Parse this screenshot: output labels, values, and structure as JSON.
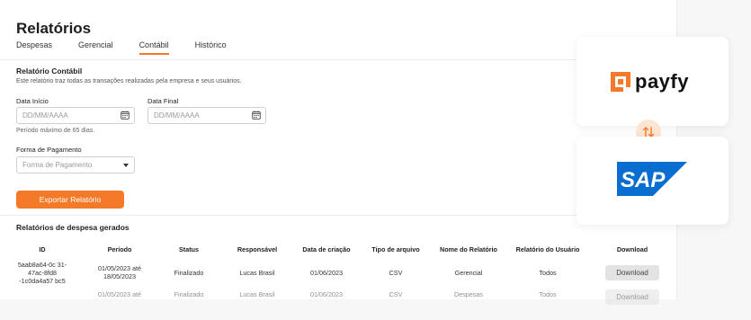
{
  "page": {
    "title": "Relatórios",
    "tabs": [
      {
        "label": "Despesas",
        "active": false
      },
      {
        "label": "Gerencial",
        "active": false
      },
      {
        "label": "Contábil",
        "active": true
      },
      {
        "label": "Histórico",
        "active": false
      }
    ]
  },
  "report": {
    "title": "Relatório Contábil",
    "description": "Este relatório traz todas as transações realizadas pela empresa e seus usuários.",
    "start_label": "Data Início",
    "start_placeholder": "DD/MM/AAAA",
    "end_label": "Data Final",
    "end_placeholder": "DD/MM/AAAA",
    "hint": "Período máximo de 65 dias.",
    "payment_label": "Forma de Pagamento",
    "payment_placeholder": "Forma de Pagamento",
    "export_label": "Exportar Relatório"
  },
  "table": {
    "title": "Relatórios de despesa gerados",
    "headers": [
      "ID",
      "Período",
      "Status",
      "Responsável",
      "Data de criação",
      "Tipo de arquivo",
      "Nome do Relatório",
      "Relatório do Usuário",
      "Download"
    ],
    "rows": [
      {
        "id": "5aab8a64-0c 31-47ac-8fd8 -1c0da4a57 bc5",
        "period": "01/05/2023 até 18/05/2023",
        "status": "Finalizado",
        "responsible": "Lucas Brasil",
        "created": "01/06/2023",
        "file_type": "CSV",
        "report_name": "Gerencial",
        "user_report": "Todos",
        "download": "Download"
      },
      {
        "id": "",
        "period": "01/05/2023 até",
        "status": "Finalizado",
        "responsible": "Lucas Brasil",
        "created": "01/06/2023",
        "file_type": "CSV",
        "report_name": "Despesas",
        "user_report": "Todos",
        "download": "Download"
      }
    ]
  },
  "integrations": {
    "payfy_text": "payfy",
    "sap_text": "SAP",
    "swap_icon": "swap-vertical-icon"
  },
  "colors": {
    "accent": "#f47a2a",
    "sap_blue": "#0a6ed1",
    "swap_bg": "#fde5d2"
  }
}
